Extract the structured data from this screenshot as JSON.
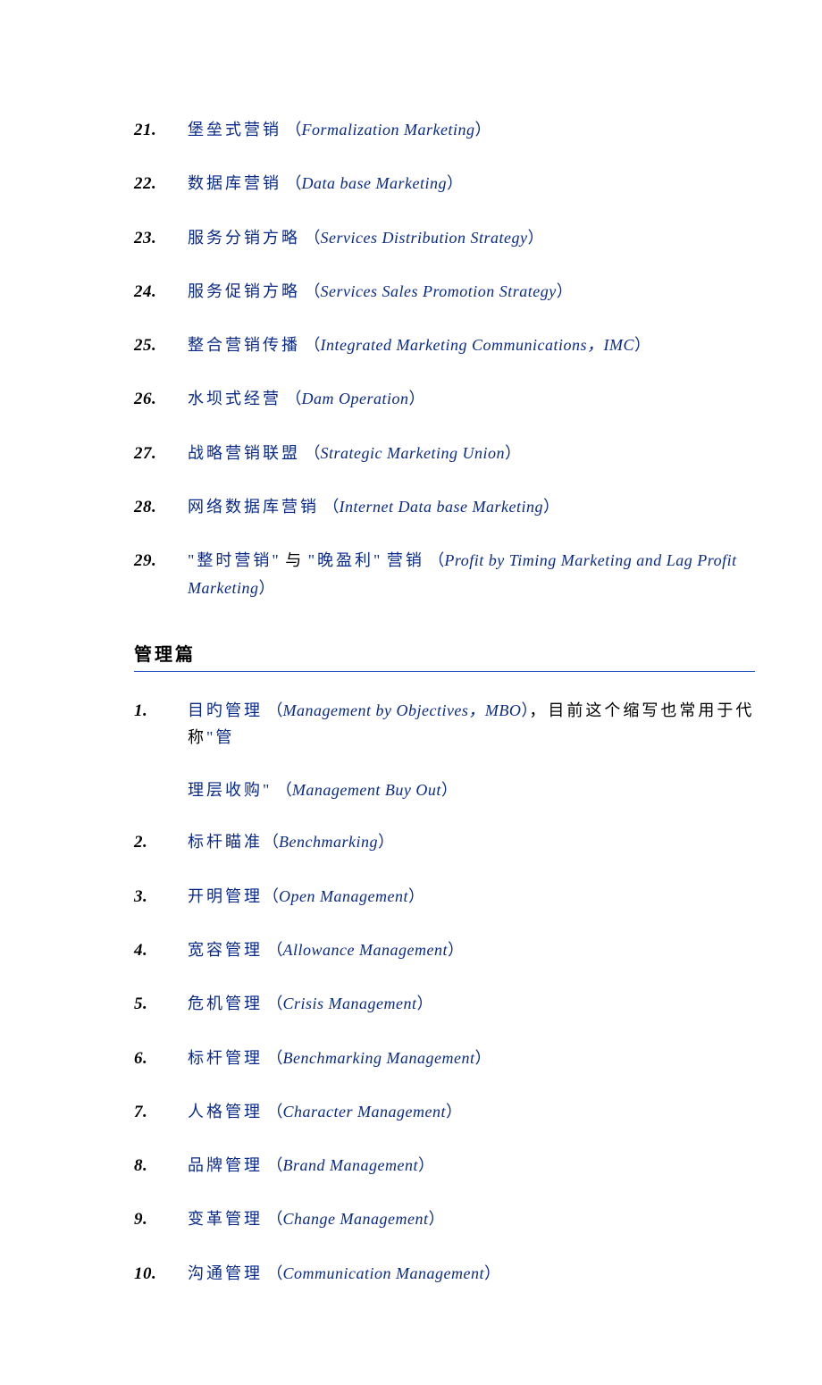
{
  "section1": {
    "items": [
      {
        "num": "21.",
        "cjk": "堡垒式营销",
        "latin": "Formalization Marketing"
      },
      {
        "num": "22.",
        "cjk": "数据库营销",
        "latin": "Data base Marketing"
      },
      {
        "num": "23.",
        "cjk": "服务分销方略",
        "latin": "Services Distribution Strategy"
      },
      {
        "num": "24.",
        "cjk": "服务促销方略",
        "latin": "Services Sales Promotion Strategy"
      },
      {
        "num": "25.",
        "cjk": "整合营销传播",
        "latin": "Integrated Marketing Communications，IMC"
      },
      {
        "num": "26.",
        "cjk": "水坝式经营",
        "latin": "Dam Operation"
      },
      {
        "num": "27.",
        "cjk": "战略营销联盟",
        "latin": "Strategic Marketing Union"
      },
      {
        "num": "28.",
        "cjk": "网络数据库营销",
        "latin": "Internet Data base Marketing"
      }
    ],
    "item29": {
      "num": "29.",
      "cjk_a": "\"整时营销\"",
      "cjk_mid": " 与",
      "cjk_b": "\"晚盈利\"",
      "cjk_c": " 营销",
      "latin": "Profit by Timing Marketing  and  Lag Profit Marketing"
    }
  },
  "section2": {
    "title": "管理篇",
    "item1": {
      "num": "1.",
      "cjk_a": "目旳管理",
      "latin_a": "Management by Objectives，MBO",
      "cjk_tail_black": "，目前这个缩写也常用于代称",
      "cjk_tail_blue": "\"管",
      "line2_cjk": "理层收购\"",
      "line2_latin": "Management Buy Out"
    },
    "items": [
      {
        "num": "2.",
        "cjk": "标杆瞄准",
        "latin": "Benchmarking",
        "nosp": true
      },
      {
        "num": "3.",
        "cjk": "开明管理",
        "latin": "Open Management",
        "nosp": true
      },
      {
        "num": "4.",
        "cjk": "宽容管理",
        "latin": "Allowance Management"
      },
      {
        "num": "5.",
        "cjk": "危机管理",
        "latin": "Crisis Management"
      },
      {
        "num": "6.",
        "cjk": "标杆管理",
        "latin": "Benchmarking Management"
      },
      {
        "num": "7.",
        "cjk": "人格管理",
        "latin": "Character Management"
      },
      {
        "num": "8.",
        "cjk": "品牌管理",
        "latin": "Brand Management"
      },
      {
        "num": "9.",
        "cjk": "变革管理",
        "latin": "Change Management"
      },
      {
        "num": "10.",
        "cjk": "沟通管理",
        "latin": "Communication Management"
      }
    ]
  }
}
